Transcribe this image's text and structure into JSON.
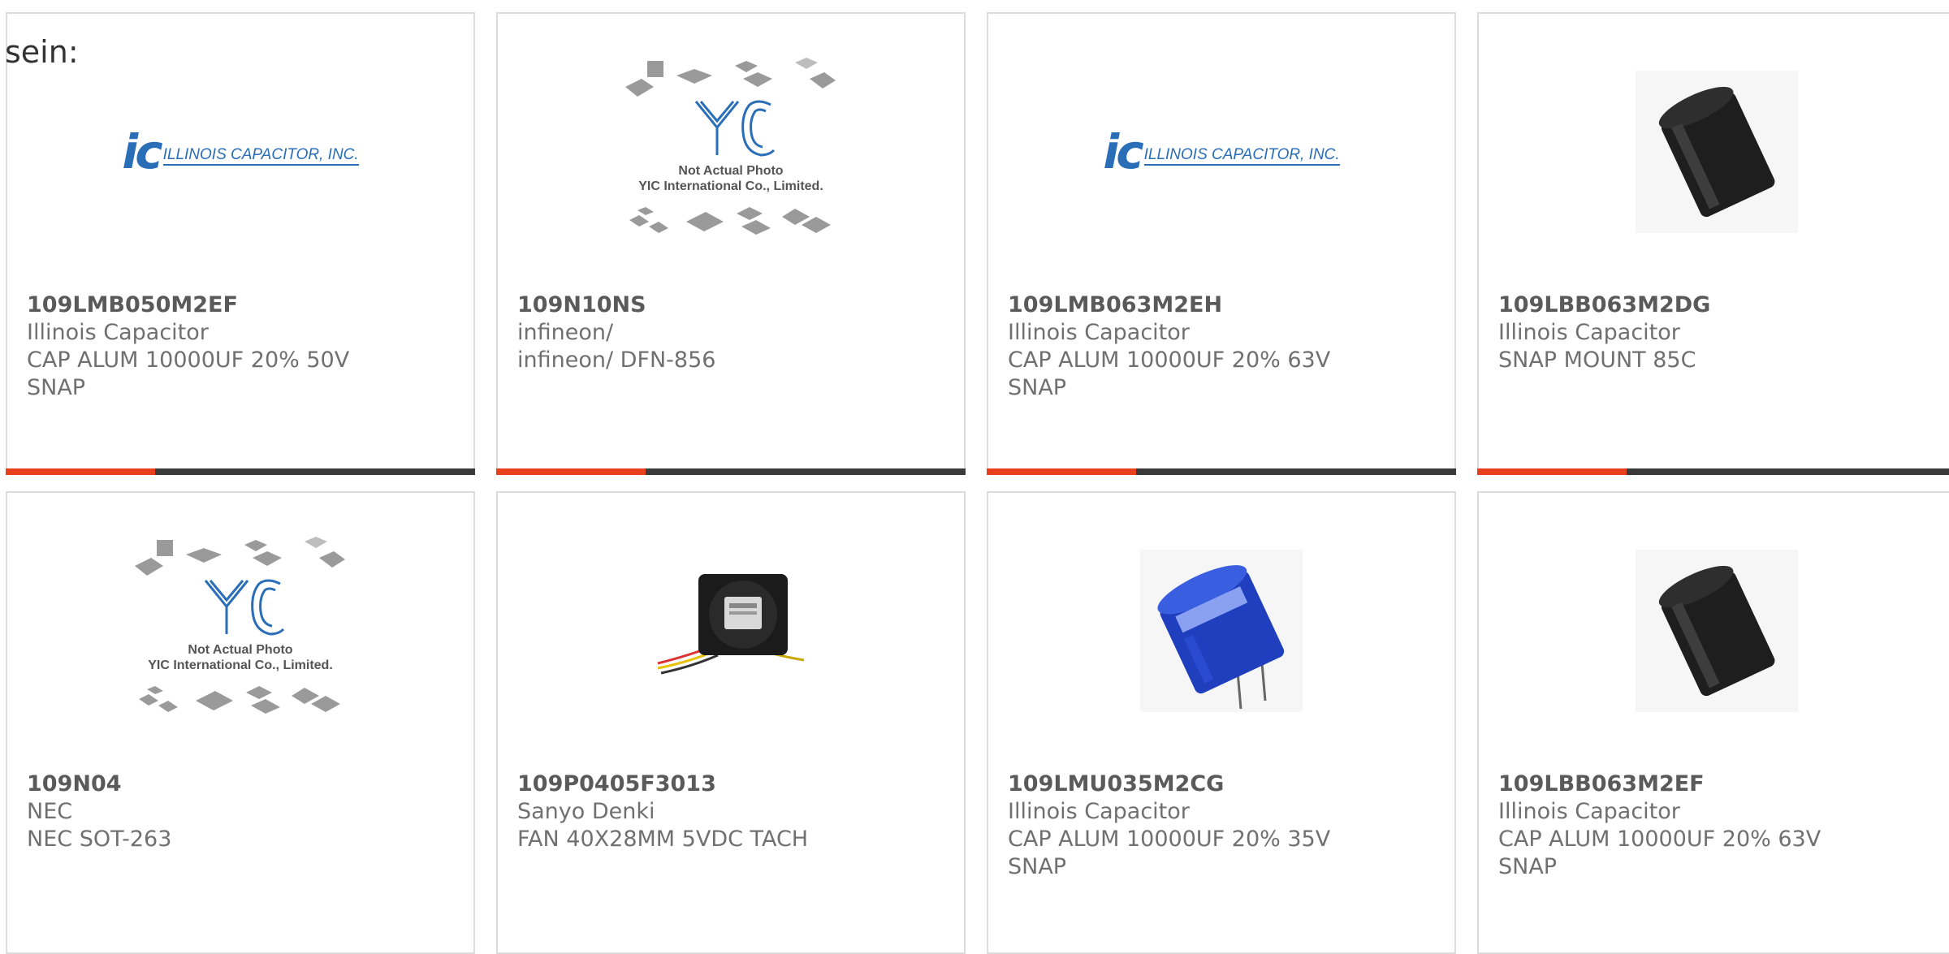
{
  "page": {
    "label": "sein:"
  },
  "colors": {
    "accent": "#e8401c",
    "bar": "#3a3a3a",
    "border": "#dcdcdc",
    "text": "#707070"
  },
  "products": [
    {
      "part_number": "109LMB050M2EF",
      "manufacturer": "Illinois Capacitor",
      "description": "CAP ALUM 10000UF 20% 50V\nSNAP",
      "image": "illinois-capacitor-logo",
      "logo_text": "ILLINOIS CAPACITOR, INC.",
      "logo_mark": "ic"
    },
    {
      "part_number": "109N10NS",
      "manufacturer": "infineon/",
      "description": "infineon/ DFN-856",
      "image": "yic-placeholder",
      "yic_line1": "Not Actual Photo",
      "yic_line2": "YIC International Co., Limited."
    },
    {
      "part_number": "109LMB063M2EH",
      "manufacturer": "Illinois Capacitor",
      "description": "CAP ALUM 10000UF 20% 63V\nSNAP",
      "image": "illinois-capacitor-logo",
      "logo_text": "ILLINOIS CAPACITOR, INC.",
      "logo_mark": "ic"
    },
    {
      "part_number": "109LBB063M2DG",
      "manufacturer": "Illinois Capacitor",
      "description": "SNAP MOUNT 85C",
      "image": "black-capacitor-photo"
    },
    {
      "part_number": "109N04",
      "manufacturer": "NEC",
      "description": "NEC SOT-263",
      "image": "yic-placeholder",
      "yic_line1": "Not Actual Photo",
      "yic_line2": "YIC International Co., Limited."
    },
    {
      "part_number": "109P0405F3013",
      "manufacturer": "Sanyo Denki",
      "description": "FAN 40X28MM 5VDC TACH",
      "image": "fan-photo"
    },
    {
      "part_number": "109LMU035M2CG",
      "manufacturer": "Illinois Capacitor",
      "description": "CAP ALUM 10000UF 20% 35V\nSNAP",
      "image": "blue-capacitor-photo"
    },
    {
      "part_number": "109LBB063M2EF",
      "manufacturer": "Illinois Capacitor",
      "description": "CAP ALUM 10000UF 20% 63V\nSNAP",
      "image": "black-capacitor-photo"
    }
  ]
}
